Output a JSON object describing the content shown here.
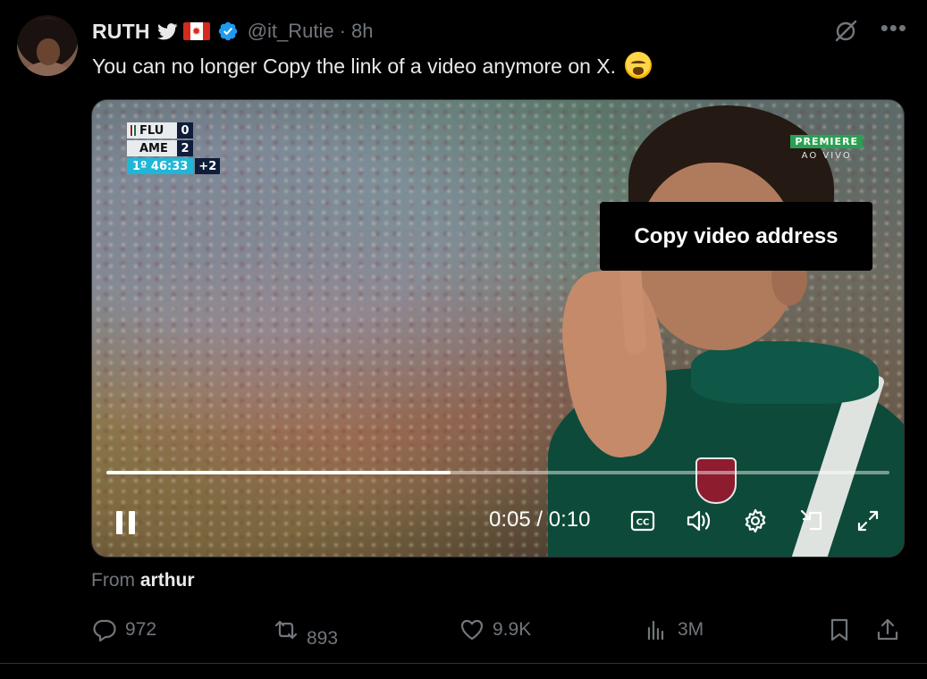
{
  "author": {
    "name": "RUTH",
    "handle": "@it_Rutie",
    "separator": "·",
    "time": "8h",
    "icons": [
      "twitter-bird-icon",
      "canada-flag-icon",
      "verified-badge-icon"
    ]
  },
  "tweet": {
    "text": "You can no longer Copy the link of a video anymore on X."
  },
  "video": {
    "scoreboard": {
      "team1": "FLU",
      "score1": "0",
      "team2": "AME",
      "score2": "2",
      "clock": "1º 46:33",
      "added": "+2"
    },
    "broadcaster": {
      "name": "PREMIERE",
      "subtitle": "AO VIVO"
    },
    "tooltip": "Copy video address",
    "time_display": "0:05 / 0:10",
    "progress": 0.44,
    "cc_label": "CC"
  },
  "source": {
    "prefix": "From",
    "name": "arthur"
  },
  "actions": {
    "replies": "972",
    "reposts": "893",
    "likes": "9.9K",
    "views": "3M"
  },
  "colors": {
    "background": "#000000",
    "text": "#e7e9ea",
    "muted": "#71767b",
    "verified": "#1d9bf0"
  }
}
